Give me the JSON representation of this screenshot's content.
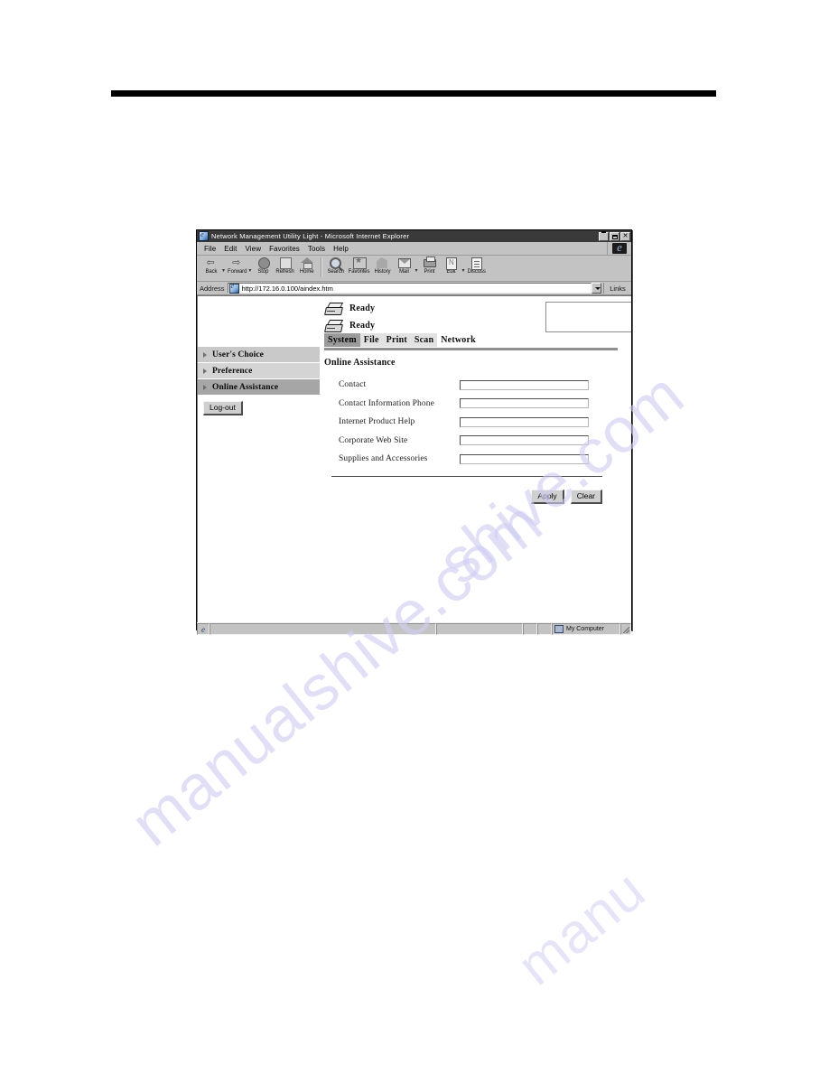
{
  "browser": {
    "title": "Network Management Utility Light - Microsoft Internet Explorer",
    "window_controls": {
      "minimize": "_",
      "maximize": "□",
      "close": "✕"
    },
    "menu": [
      "File",
      "Edit",
      "View",
      "Favorites",
      "Tools",
      "Help"
    ],
    "toolbar": [
      {
        "label": "Back",
        "icon": "back-arrow-icon",
        "has_dropdown": true
      },
      {
        "label": "Forward",
        "icon": "forward-arrow-icon",
        "has_dropdown": true
      },
      {
        "label": "Stop",
        "icon": "stop-icon",
        "has_dropdown": false
      },
      {
        "label": "Refresh",
        "icon": "refresh-icon",
        "has_dropdown": false
      },
      {
        "label": "Home",
        "icon": "home-icon",
        "has_dropdown": false
      },
      {
        "label": "Search",
        "icon": "search-icon",
        "has_dropdown": false
      },
      {
        "label": "Favorites",
        "icon": "favorites-star-icon",
        "has_dropdown": false
      },
      {
        "label": "History",
        "icon": "history-icon",
        "has_dropdown": false
      },
      {
        "label": "Mail",
        "icon": "mail-icon",
        "has_dropdown": true
      },
      {
        "label": "Print",
        "icon": "printer-icon",
        "has_dropdown": false
      },
      {
        "label": "Edit",
        "icon": "edit-page-icon",
        "has_dropdown": true
      },
      {
        "label": "Discuss",
        "icon": "discuss-icon",
        "has_dropdown": false
      }
    ],
    "address": {
      "label": "Address",
      "url": "http://172.16.0.100/aindex.htm",
      "links_label": "Links"
    },
    "statusbar": {
      "message": "",
      "zone": "My Computer"
    }
  },
  "page": {
    "device_status": [
      {
        "icon": "printer-icon",
        "state": "Ready"
      },
      {
        "icon": "printer-icon",
        "state": "Ready"
      }
    ],
    "message_box_value": "",
    "tabs": [
      {
        "label": "System",
        "state": "selected"
      },
      {
        "label": "File",
        "state": "light"
      },
      {
        "label": "Print",
        "state": "light"
      },
      {
        "label": "Scan",
        "state": "light"
      },
      {
        "label": "Network",
        "state": "plain"
      }
    ],
    "sidebar": {
      "items": [
        {
          "label": "User's Choice",
          "active": false
        },
        {
          "label": "Preference",
          "active": false
        },
        {
          "label": "Online Assistance",
          "active": true
        }
      ],
      "logout_label": "Log-out"
    },
    "section_title": "Online Assistance",
    "fields": [
      {
        "label": "Contact",
        "value": ""
      },
      {
        "label": "Contact Information Phone",
        "value": ""
      },
      {
        "label": "Internet Product Help",
        "value": ""
      },
      {
        "label": "Corporate Web Site",
        "value": ""
      },
      {
        "label": "Supplies and Accessories",
        "value": ""
      }
    ],
    "buttons": {
      "apply": "Apply",
      "clear": "Clear"
    }
  },
  "watermark": {
    "text": "manualshive.com",
    "fragment_a": "manualshive.com",
    "fragment_b": "shive.com",
    "fragment_c": "manu"
  }
}
